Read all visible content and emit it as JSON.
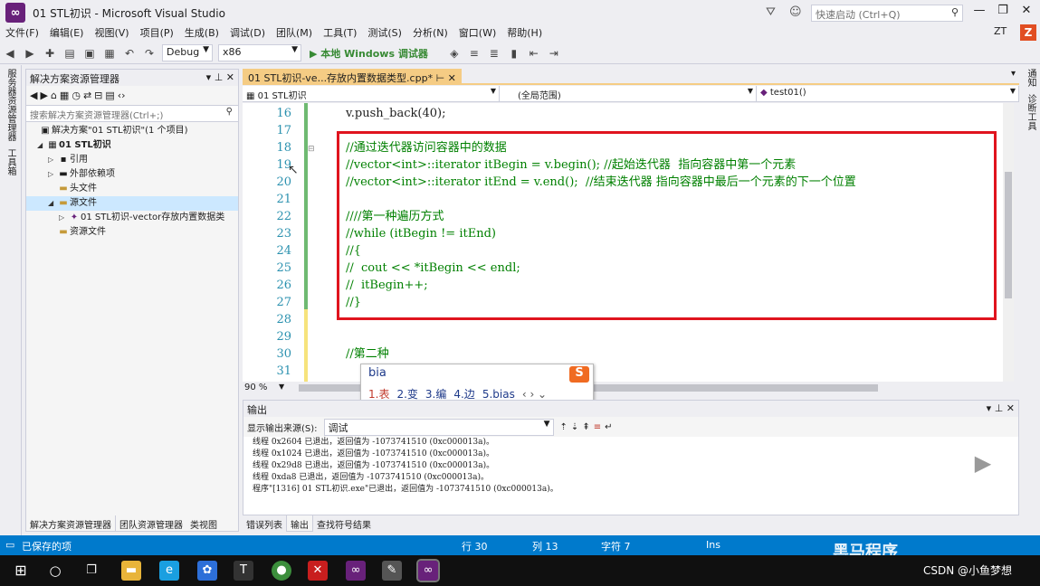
{
  "window": {
    "title": "01 STL初识 - Microsoft Visual Studio",
    "quick_launch": "快速启动 (Ctrl+Q)",
    "user": "ZT",
    "user_badge": "Z"
  },
  "menu": [
    "文件(F)",
    "编辑(E)",
    "视图(V)",
    "项目(P)",
    "生成(B)",
    "调试(D)",
    "团队(M)",
    "工具(T)",
    "测试(S)",
    "分析(N)",
    "窗口(W)",
    "帮助(H)"
  ],
  "toolbar": {
    "config": "Debug",
    "platform": "x86",
    "run": "▶ 本地 Windows 调试器"
  },
  "left_strip": [
    "服务器资源管理器",
    "工具箱"
  ],
  "right_strip": [
    "通知",
    "诊断工具"
  ],
  "solution_explorer": {
    "title": "解决方案资源管理器",
    "search_placeholder": "搜索解决方案资源管理器(Ctrl+;)",
    "items": [
      {
        "label": "解决方案\"01 STL初识\"(1 个项目)",
        "indent": 0
      },
      {
        "label": "01 STL初识",
        "indent": 1
      },
      {
        "label": "引用",
        "indent": 2
      },
      {
        "label": "外部依赖项",
        "indent": 2
      },
      {
        "label": "头文件",
        "indent": 2
      },
      {
        "label": "源文件",
        "indent": 2
      },
      {
        "label": "01 STL初识-vector存放内置数据类",
        "indent": 3
      },
      {
        "label": "资源文件",
        "indent": 2
      }
    ],
    "tabs": [
      "解决方案资源管理器",
      "团队资源管理器",
      "类视图"
    ]
  },
  "editor": {
    "tab": "01 STL初识-ve...存放内置数据类型.cpp*",
    "nav": [
      "01 STL初识",
      "(全局范围)",
      "test01()"
    ],
    "line_numbers": [
      "16",
      "17",
      "18",
      "19",
      "20",
      "21",
      "22",
      "23",
      "24",
      "25",
      "26",
      "27",
      "28",
      "29",
      "30",
      "31"
    ],
    "lines": [
      "v.push_back(40);",
      "",
      "//通过迭代器访问容器中的数据",
      "//vector<int>::iterator itBegin = v.begin(); //起始迭代器  指向容器中第一个元素",
      "//vector<int>::iterator itEnd = v.end();  //结束迭代器 指向容器中最后一个元素的下一个位置",
      "",
      "////第一种遍历方式",
      "//while (itBegin != itEnd)",
      "//{",
      "//  cout << *itBegin << endl;",
      "//  itBegin++;",
      "//}",
      "",
      "",
      "//第二种",
      ""
    ],
    "zoom": "90 %"
  },
  "ime": {
    "input": "bia",
    "candidates": [
      "1.表",
      "2.变",
      "3.编",
      "4.边",
      "5.bias"
    ],
    "logo": "S"
  },
  "output": {
    "title": "输出",
    "source_label": "显示输出来源(S):",
    "source_value": "调试",
    "lines": [
      "线程 0x2604 已退出，返回值为 -1073741510 (0xc000013a)。",
      "线程 0x1024 已退出，返回值为 -1073741510 (0xc000013a)。",
      "线程 0x29d8 已退出，返回值为 -1073741510 (0xc000013a)。",
      "线程 0xda8 已退出，返回值为 -1073741510 (0xc000013a)。",
      "程序\"[1316] 01 STL初识.exe\"已退出，返回值为 -1073741510 (0xc000013a)。"
    ],
    "tabs": [
      "错误列表",
      "输出",
      "查找符号结果"
    ]
  },
  "status": {
    "message": "已保存的项",
    "line": "行 30",
    "col": "列 13",
    "char": "字符 7",
    "mode": "Ins"
  },
  "overlay": {
    "watermark": "黑马程序",
    "csdn": "CSDN @小鱼梦想"
  },
  "colors": {
    "accent": "#007ACC",
    "tab": "#F5CC84",
    "highlight_box": "#E0141E",
    "comment": "#008000"
  }
}
